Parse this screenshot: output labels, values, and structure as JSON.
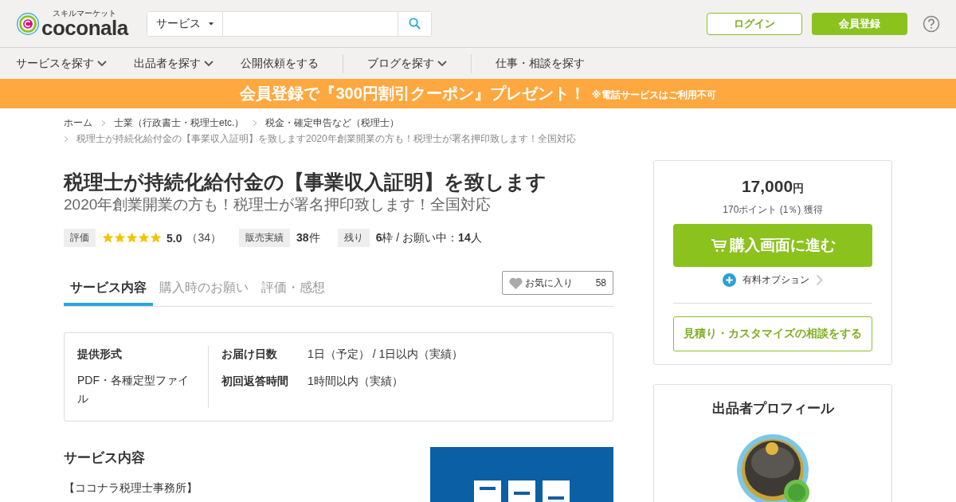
{
  "header": {
    "logo_tagline": "スキルマーケット",
    "logo_text": "coconala",
    "search": {
      "category": "サービス"
    },
    "login": "ログイン",
    "signup": "会員登録"
  },
  "nav": [
    [
      {
        "label": "サービスを探す",
        "dropdown": true
      },
      {
        "label": "出品者を探す",
        "dropdown": true
      },
      {
        "label": "公開依頼をする",
        "dropdown": false
      }
    ],
    [
      {
        "label": "ブログを探す",
        "dropdown": true
      }
    ],
    [
      {
        "label": "仕事・相談を探す",
        "dropdown": false
      }
    ]
  ],
  "banner": {
    "text": "会員登録で『300円割引クーポン』プレゼント！",
    "note": "※電話サービスはご利用不可"
  },
  "breadcrumbs": [
    "ホーム",
    "士業（行政書士・税理士etc.）",
    "税金・確定申告など（税理士）",
    "税理士が持続化給付金の【事業収入証明】を致します2020年創業開業の方も！税理士が署名押印致します！全国対応"
  ],
  "title": "税理士が持続化給付金の【事業収入証明】を致します",
  "subtitle": "2020年創業開業の方も！税理士が署名押印致します！全国対応",
  "stats": {
    "rating_label": "評価",
    "stars": 5,
    "rating": "5.0",
    "reviews": "（34）",
    "sales_label": "販売実績",
    "sales": "38",
    "sales_unit": "件",
    "remaining_label": "残り",
    "remaining": "6",
    "remaining_unit": "枠 / お願い中：",
    "requesting": "14",
    "requesting_unit": "人"
  },
  "tabs": [
    {
      "label": "サービス内容",
      "selected": true
    },
    {
      "label": "購入時のお願い",
      "selected": false
    },
    {
      "label": "評価・感想",
      "selected": false
    }
  ],
  "favorite": {
    "label": "お気に入り",
    "count": "58"
  },
  "info": {
    "format_label": "提供形式",
    "format_value": "PDF・各種定型ファイル",
    "rows": [
      {
        "label": "お届け日数",
        "value": "1日（予定） / 1日以内（実績）"
      },
      {
        "label": "初回返答時間",
        "value": "1時間以内（実績）"
      }
    ]
  },
  "description": {
    "heading": "サービス内容",
    "lines": [
      "【ココナラ税理士事務所】"
    ]
  },
  "purchase": {
    "price": "17,000",
    "currency": "円",
    "points": "170ポイント (1％) 獲得",
    "buy": "購入画面に進む",
    "options": "有料オプション",
    "consult": "見積り・カスタマイズの相談をする"
  },
  "profile": {
    "heading": "出品者プロフィール"
  }
}
